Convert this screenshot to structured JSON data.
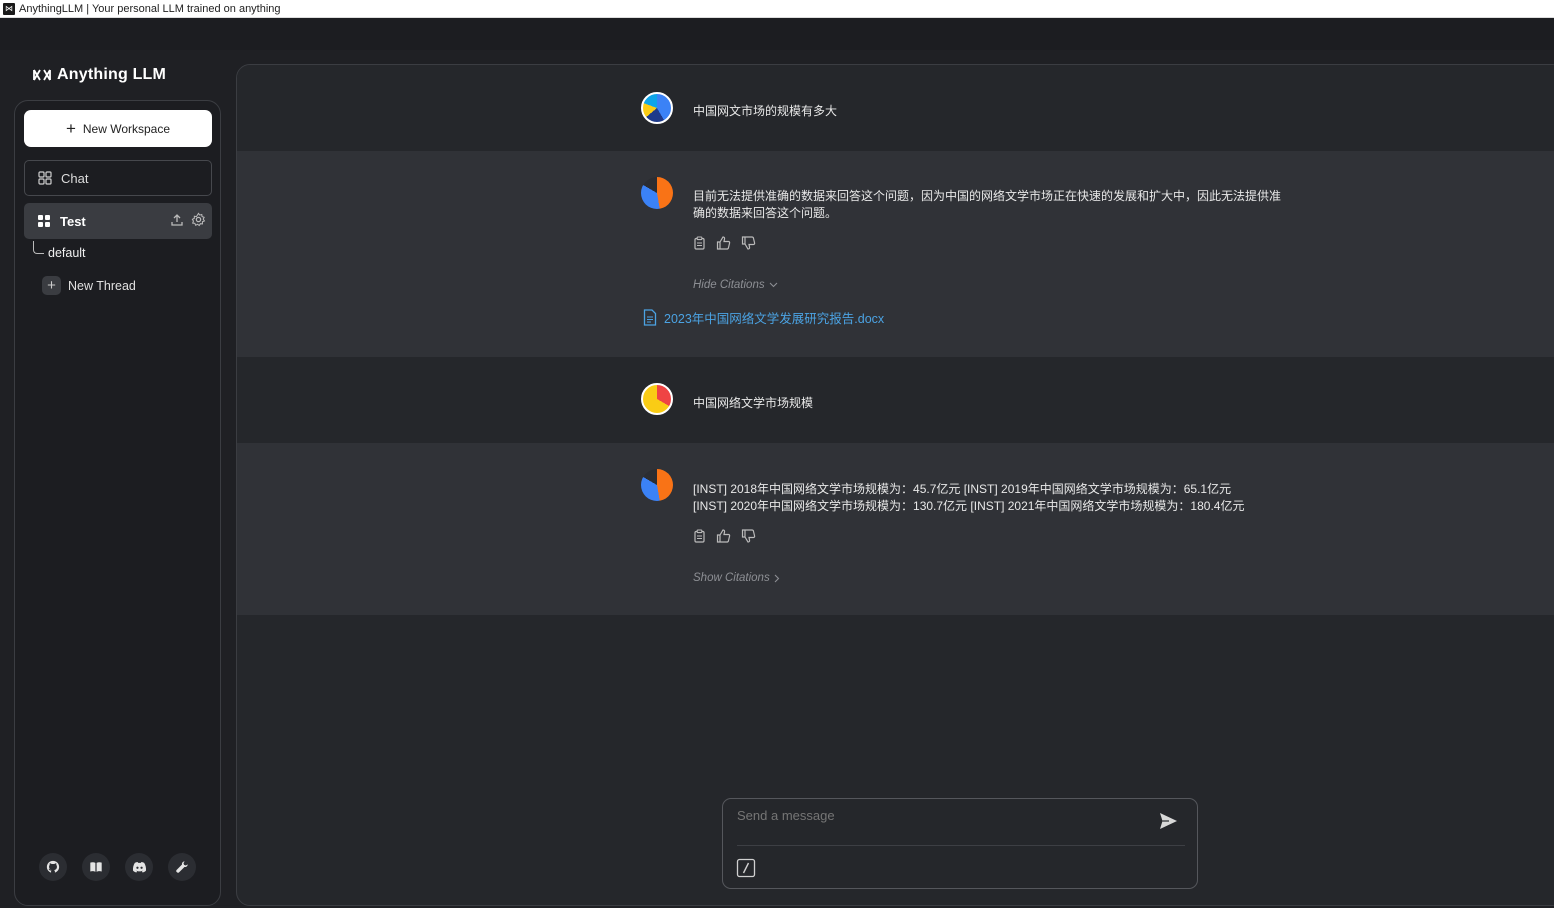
{
  "window": {
    "title": "AnythingLLM | Your personal LLM trained on anything"
  },
  "app": {
    "logo_text": "Anything LLM"
  },
  "sidebar": {
    "new_workspace_label": "New Workspace",
    "chat_label": "Chat",
    "workspace": {
      "name": "Test",
      "threads": [
        {
          "label": "default"
        }
      ],
      "new_thread_label": "New Thread"
    },
    "footer_icons": [
      "github-icon",
      "docs-icon",
      "discord-icon",
      "settings-wrench-icon"
    ]
  },
  "chat": {
    "messages": [
      {
        "role": "user",
        "text": "中国网文市场的规模有多大"
      },
      {
        "role": "assistant",
        "text": "目前无法提供准确的数据来回答这个问题，因为中国的网络文学市场正在快速的发展和扩大中，因此无法提供准确的数据来回答这个问题。",
        "citations_toggle": "Hide Citations",
        "citations": [
          "2023年中国网络文学发展研究报告.docx"
        ]
      },
      {
        "role": "user",
        "text": "中国网络文学市场规模"
      },
      {
        "role": "assistant",
        "text": "[INST] 2018年中国网络文学市场规模为：45.7亿元 [INST] 2019年中国网络文学市场规模为：65.1亿元 [INST] 2020年中国网络文学市场规模为：130.7亿元 [INST] 2021年中国网络文学市场规模为：180.4亿元",
        "citations_toggle": "Show Citations"
      }
    ]
  },
  "composer": {
    "placeholder": "Send a message"
  },
  "colors": {
    "background": "#25272b",
    "assistant_row": "#303237",
    "sidebar": "#1c1d21",
    "citation_link": "#4ba3e3"
  }
}
